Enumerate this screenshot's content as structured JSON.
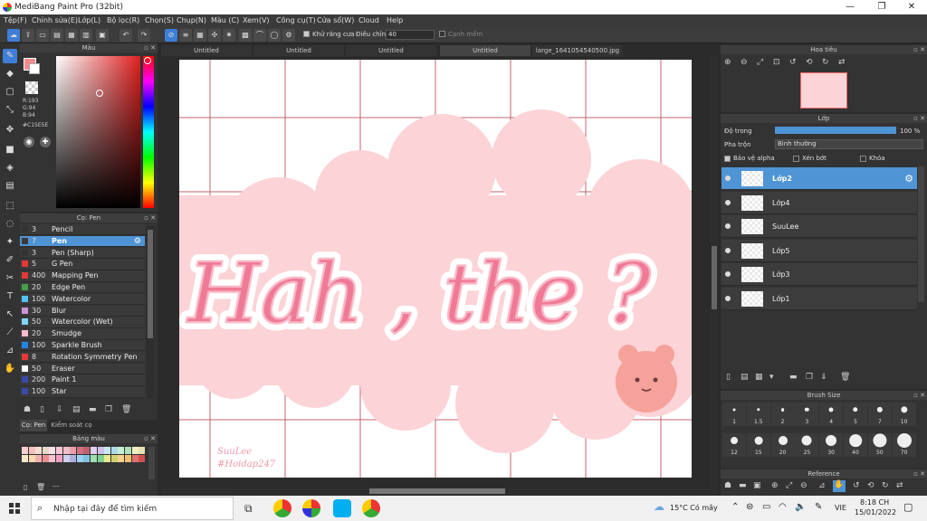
{
  "window": {
    "title": "MediBang Paint Pro (32bit)",
    "minimize": "—",
    "maximize": "❐",
    "close": "✕"
  },
  "menu": [
    "Tệp(F)",
    "Chỉnh sửa(E)",
    "Lớp(L)",
    "Bộ lọc(R)",
    "Chọn(S)",
    "Chụp(N)",
    "Màu (C)",
    "Xem(V)",
    "Công cụ(T)",
    "Cửa sổ(W)",
    "Cloud",
    "Help"
  ],
  "toolbar": {
    "antialias_label": "Khử răng cưa",
    "adjust_label": "Điều chỉnh",
    "adjust_value": "40",
    "snap_label": "Cạnh mềm"
  },
  "doc_tabs": [
    "Untitled",
    "Untitled",
    "Untitled",
    "Untitled",
    "large_1641054540500.jpg"
  ],
  "color_panel": {
    "title": "Màu",
    "r": "R:193",
    "g": "G:94",
    "b": "B:94",
    "hex": "#C15E5E",
    "fg_color": "#c15e5e"
  },
  "brush_panel": {
    "title": "Cọ: Pen",
    "brushes": [
      {
        "size": "3",
        "name": "Pencil",
        "color": "#333333"
      },
      {
        "size": "7",
        "name": "Pen",
        "color": "#3a3a3a",
        "selected": true
      },
      {
        "size": "3",
        "name": "Pen (Sharp)",
        "color": "#333333"
      },
      {
        "size": "5",
        "name": "G Pen",
        "color": "#e53935"
      },
      {
        "size": "400",
        "name": "Mapping Pen",
        "color": "#e53935"
      },
      {
        "size": "20",
        "name": "Edge Pen",
        "color": "#43a047"
      },
      {
        "size": "100",
        "name": "Watercolor",
        "color": "#4fc3f7"
      },
      {
        "size": "30",
        "name": "Blur",
        "color": "#ce93d8"
      },
      {
        "size": "50",
        "name": "Watercolor (Wet)",
        "color": "#81d4fa"
      },
      {
        "size": "20",
        "name": "Smudge",
        "color": "#f8bbd0"
      },
      {
        "size": "100",
        "name": "Sparkle Brush",
        "color": "#1e88e5"
      },
      {
        "size": "8",
        "name": "Rotation Symmetry Pen",
        "color": "#e53935"
      },
      {
        "size": "50",
        "name": "Eraser",
        "color": "#ffffff"
      },
      {
        "size": "200",
        "name": "Paint 1",
        "color": "#3949ab"
      },
      {
        "size": "100",
        "name": "Star",
        "color": "#3949ab"
      }
    ],
    "tabs": [
      "Cọ: Pen",
      "Kiểm soát cọ"
    ]
  },
  "palette_panel": {
    "title": "Bảng màu",
    "footer": "---"
  },
  "canvas": {
    "main_text": "Hah , the ?",
    "signature_line1": "SuuLee",
    "signature_line2": "#Hoidap247"
  },
  "navigator": {
    "title": "Hoa tiêu"
  },
  "layer_panel": {
    "title": "Lớp",
    "opacity_label": "Độ trong",
    "opacity_value": "100 %",
    "blend_label": "Pha trộn",
    "blend_value": "Bình thường",
    "protect_alpha": "Bảo vệ alpha",
    "clip": "Xén bớt",
    "lock": "Khóa",
    "layers": [
      {
        "name": "Lớp2",
        "selected": true
      },
      {
        "name": "Lớp4"
      },
      {
        "name": "SuuLee"
      },
      {
        "name": "Lớp5"
      },
      {
        "name": "Lớp3"
      },
      {
        "name": "Lớp1"
      }
    ]
  },
  "brush_size_panel": {
    "title": "Brush Size",
    "sizes": [
      "1",
      "1.5",
      "2",
      "3",
      "4",
      "5",
      "7",
      "10",
      "12",
      "15",
      "20",
      "25",
      "30",
      "40",
      "50",
      "70"
    ]
  },
  "reference_panel": {
    "title": "Reference"
  },
  "taskbar": {
    "search_placeholder": "Nhập tại đây để tìm kiếm",
    "weather": "15°C  Có mây",
    "lang": "VIE",
    "time": "8:18 CH",
    "date": "15/01/2022"
  }
}
